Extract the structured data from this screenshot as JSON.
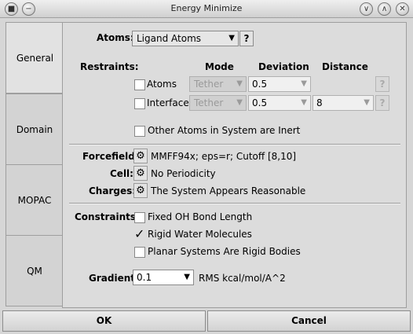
{
  "window": {
    "title": "Energy Minimize"
  },
  "tabs": [
    {
      "label": "General"
    },
    {
      "label": "Domain"
    },
    {
      "label": "MOPAC"
    },
    {
      "label": "QM"
    }
  ],
  "atoms": {
    "label": "Atoms:",
    "value": "Ligand Atoms",
    "help": "?"
  },
  "restraints": {
    "label": "Restraints:",
    "headers": {
      "mode": "Mode",
      "deviation": "Deviation",
      "distance": "Distance"
    },
    "rows": [
      {
        "label": "Atoms",
        "mode": "Tether",
        "deviation": "0.5",
        "distance": "",
        "help": "?"
      },
      {
        "label": "Interface",
        "mode": "Tether",
        "deviation": "0.5",
        "distance": "8",
        "help": "?"
      }
    ],
    "inert_label": "Other Atoms in System are Inert"
  },
  "forcefield": {
    "label": "Forcefield:",
    "value": "MMFF94x;  eps=r;  Cutoff [8,10]"
  },
  "cell": {
    "label": "Cell:",
    "value": "No Periodicity"
  },
  "charges": {
    "label": "Charges:",
    "value": "The System Appears Reasonable"
  },
  "constraints": {
    "label": "Constraints:",
    "items": [
      {
        "label": "Fixed OH Bond Length",
        "checked": false
      },
      {
        "label": "Rigid Water Molecules",
        "checked": true
      },
      {
        "label": "Planar Systems Are Rigid Bodies",
        "checked": false
      }
    ]
  },
  "gradient": {
    "label": "Gradient:",
    "value": "0.1",
    "units": "RMS kcal/mol/A^2"
  },
  "buttons": {
    "ok": "OK",
    "cancel": "Cancel"
  }
}
